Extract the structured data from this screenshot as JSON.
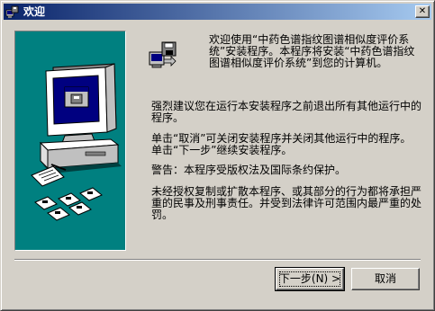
{
  "window": {
    "title": "欢迎",
    "close_glyph": "✕"
  },
  "content": {
    "intro": "欢迎使用“中药色谱指纹图谱相似度评价系统”安装程序。本程序将安装“中药色谱指纹图谱相似度评价系统”到您的计算机。",
    "paragraph1": "强烈建议您在运行本安装程序之前退出所有其他运行中的程序。",
    "paragraph2": "单击“取消”可关闭安装程序并关闭其他运行中的程序。单击“下一步”继续安装程序。",
    "paragraph3": "警告：本程序受版权法及国际条约保护。",
    "paragraph4": "未经授权复制或扩散本程序、或其部分的行为都将承担严重的民事及刑事责任。并受到法律许可范围内最严重的处罚。"
  },
  "buttons": {
    "next_label": "下一步(N) >",
    "cancel_label": "取消"
  },
  "colors": {
    "titlebar_start": "#0a246a",
    "titlebar_end": "#a6caf0",
    "panel": "#008080",
    "dialog": "#d4d0c8"
  },
  "icons": {
    "title": "setup-icon",
    "setup": "setup-icon",
    "art": "computer-with-disks-illustration"
  }
}
